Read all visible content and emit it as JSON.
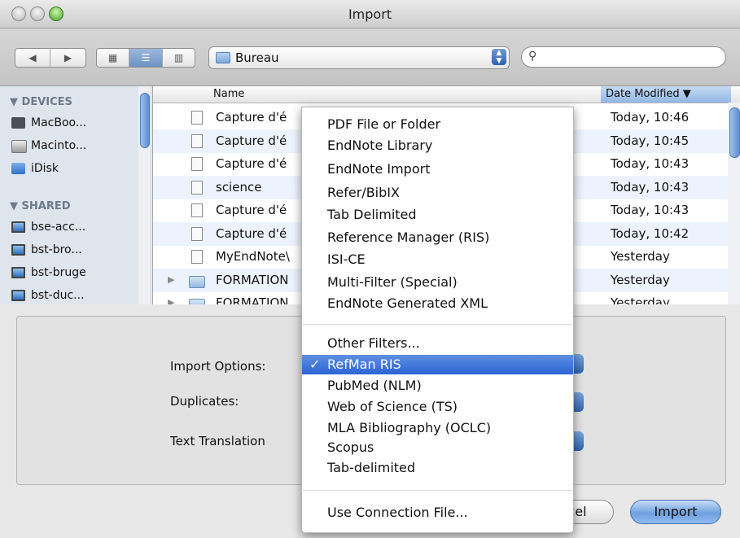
{
  "window": {
    "title": "Import"
  },
  "toolbar": {
    "location": "Bureau",
    "nav_back": "◀",
    "nav_forward": "▶",
    "view_icon": "▦",
    "view_list": "☰",
    "view_column": "▥",
    "search_placeholder": "",
    "search_icon": "⚲"
  },
  "sidebar": {
    "devices_header": "▼ DEVICES",
    "devices": [
      "MacBoo...",
      "Macinto...",
      "iDisk"
    ],
    "shared_header": "▼ SHARED",
    "shared": [
      "bse-acc...",
      "bst-bro...",
      "bst-bruge",
      "bst-duc..."
    ]
  },
  "file_list": {
    "col_name": "Name",
    "col_date": "Date Modified ▼",
    "rows": [
      {
        "name": "Capture d'é",
        "date": "Today, 10:46",
        "type": "file"
      },
      {
        "name": "Capture d'é",
        "date": "Today, 10:45",
        "type": "file"
      },
      {
        "name": "Capture d'é",
        "date": "Today, 10:43",
        "type": "file"
      },
      {
        "name": "science",
        "date": "Today, 10:43",
        "type": "doc"
      },
      {
        "name": "Capture d'é",
        "date": "Today, 10:43",
        "type": "file"
      },
      {
        "name": "Capture d'é",
        "date": "Today, 10:42",
        "type": "file"
      },
      {
        "name": "MyEndNote\\",
        "date": "Yesterday",
        "type": "file"
      },
      {
        "name": "FORMATION",
        "date": "Yesterday",
        "type": "folder"
      },
      {
        "name": "FORMATION",
        "date": "Yesterday",
        "type": "folder"
      }
    ]
  },
  "options": {
    "import_options_label": "Import Options:",
    "duplicates_label": "Duplicates:",
    "text_translation_label": "Text Translation"
  },
  "buttons": {
    "cancel": "cel",
    "import": "Import"
  },
  "menu": {
    "group1": [
      "PDF File or Folder",
      "EndNote Library",
      "EndNote Import",
      "Refer/BibIX",
      "Tab Delimited",
      "Reference Manager (RIS)",
      "ISI-CE",
      "Multi-Filter (Special)",
      "EndNote Generated XML"
    ],
    "group2": [
      "Other Filters...",
      "RefMan RIS",
      "PubMed (NLM)",
      "Web of Science (TS)",
      "MLA Bibliography (OCLC)",
      "Scopus",
      "Tab-delimited"
    ],
    "group3": [
      "Use Connection File..."
    ],
    "selected": "RefMan RIS",
    "check": "✓"
  },
  "colors": {
    "selection": "#2b63d6",
    "accent": "#6fa0df"
  }
}
